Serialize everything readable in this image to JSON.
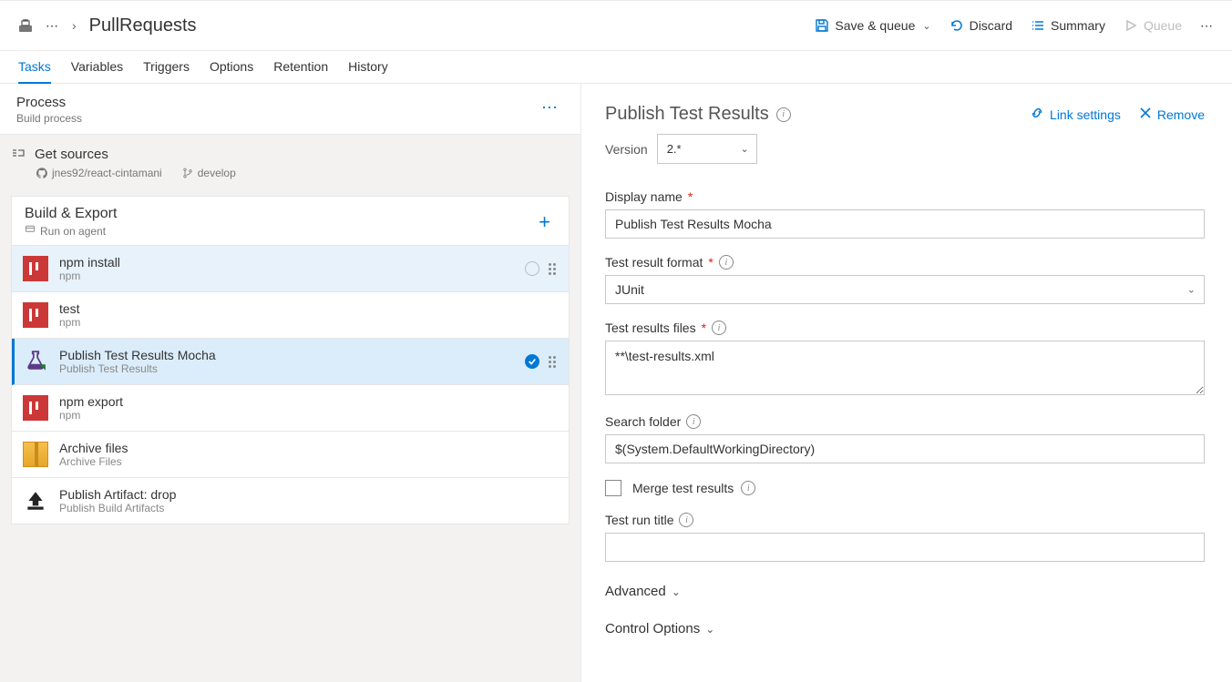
{
  "breadcrumb": {
    "title": "PullRequests"
  },
  "top_actions": {
    "save_queue": "Save & queue",
    "discard": "Discard",
    "summary": "Summary",
    "queue": "Queue"
  },
  "tabs": [
    "Tasks",
    "Variables",
    "Triggers",
    "Options",
    "Retention",
    "History"
  ],
  "process": {
    "title": "Process",
    "subtitle": "Build process"
  },
  "get_sources": {
    "title": "Get sources",
    "repo": "jnes92/react-cintamani",
    "branch": "develop"
  },
  "phase": {
    "title": "Build & Export",
    "subtitle": "Run on agent"
  },
  "tasks": [
    {
      "title": "npm install",
      "sub": "npm",
      "icon": "npm",
      "status": "circle"
    },
    {
      "title": "test",
      "sub": "npm",
      "icon": "npm"
    },
    {
      "title": "Publish Test Results Mocha",
      "sub": "Publish Test Results",
      "icon": "flask",
      "status": "check",
      "selected": true
    },
    {
      "title": "npm export",
      "sub": "npm",
      "icon": "npm"
    },
    {
      "title": "Archive files",
      "sub": "Archive Files",
      "icon": "archive"
    },
    {
      "title": "Publish Artifact: drop",
      "sub": "Publish Build Artifacts",
      "icon": "upload"
    }
  ],
  "details": {
    "heading": "Publish Test Results",
    "link_settings": "Link settings",
    "remove": "Remove",
    "version_label": "Version",
    "version_value": "2.*",
    "display_name_label": "Display name",
    "display_name_value": "Publish Test Results Mocha",
    "format_label": "Test result format",
    "format_value": "JUnit",
    "files_label": "Test results files",
    "files_value": "**\\test-results.xml",
    "search_label": "Search folder",
    "search_value": "$(System.DefaultWorkingDirectory)",
    "merge_label": "Merge test results",
    "run_title_label": "Test run title",
    "run_title_value": "",
    "advanced": "Advanced",
    "control_options": "Control Options"
  }
}
